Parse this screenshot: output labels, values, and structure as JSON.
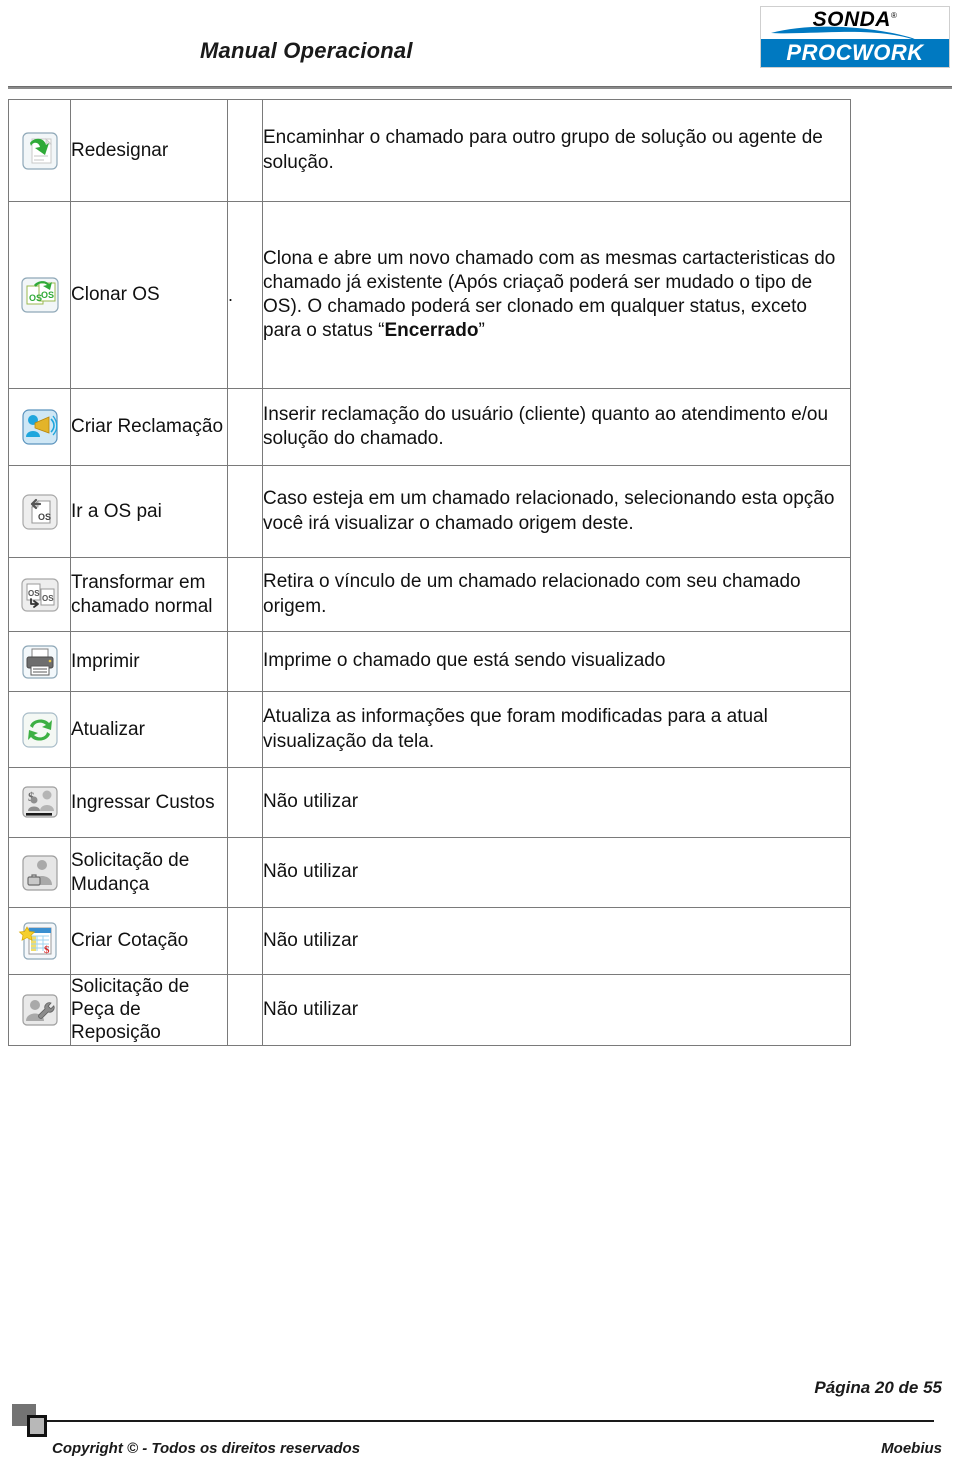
{
  "header": {
    "title": "Manual Operacional",
    "logo": {
      "top_text": "SONDA",
      "registered_mark": "®",
      "bottom_text": "PROCWORK",
      "brand_blue": "#0079c1"
    }
  },
  "table": {
    "rows": [
      {
        "icon": "redesignar-icon",
        "label": "Redesignar",
        "spacer": "",
        "desc_pre": "Encaminhar o chamado para outro grupo de solução ou agente de solução.",
        "desc_bold": "",
        "desc_post": ""
      },
      {
        "icon": "clonar-os-icon",
        "label": "Clonar OS",
        "spacer": ".",
        "desc_pre": "Clona e abre um novo chamado com as mesmas cartacteristicas do chamado já existente (Após criaçaõ poderá ser mudado o tipo de OS). O chamado poderá ser clonado em qualquer status, exceto para o status “",
        "desc_bold": "Encerrado",
        "desc_post": "”"
      },
      {
        "icon": "criar-reclamacao-icon",
        "label": "Criar Reclamação",
        "spacer": "",
        "desc_pre": "Inserir reclamação do usuário (cliente) quanto ao atendimento e/ou solução do chamado.",
        "desc_bold": "",
        "desc_post": ""
      },
      {
        "icon": "ir-a-os-pai-icon",
        "label": "Ir a OS pai",
        "spacer": "",
        "desc_pre": "Caso esteja em um chamado relacionado, selecionando esta opção você irá visualizar o chamado origem deste.",
        "desc_bold": "",
        "desc_post": ""
      },
      {
        "icon": "transformar-chamado-normal-icon",
        "label": "Transformar em chamado normal",
        "spacer": "",
        "desc_pre": "Retira o vínculo de um chamado relacionado com seu chamado origem.",
        "desc_bold": "",
        "desc_post": ""
      },
      {
        "icon": "imprimir-icon",
        "label": "Imprimir",
        "spacer": "",
        "desc_pre": "Imprime o chamado que está sendo visualizado",
        "desc_bold": "",
        "desc_post": ""
      },
      {
        "icon": "atualizar-icon",
        "label": "Atualizar",
        "spacer": "",
        "desc_pre": "Atualiza as informações que foram modificadas para a atual visualização da tela.",
        "desc_bold": "",
        "desc_post": ""
      },
      {
        "icon": "ingressar-custos-icon",
        "label": "Ingressar Custos",
        "spacer": "",
        "desc_pre": "Não utilizar",
        "desc_bold": "",
        "desc_post": ""
      },
      {
        "icon": "solicitacao-mudanca-icon",
        "label": "Solicitação de Mudança",
        "spacer": "",
        "desc_pre": "Não utilizar",
        "desc_bold": "",
        "desc_post": ""
      },
      {
        "icon": "criar-cotacao-icon",
        "label": "Criar Cotação",
        "spacer": "",
        "desc_pre": "Não utilizar",
        "desc_bold": "",
        "desc_post": ""
      },
      {
        "icon": "solicitacao-peca-reposicao-icon",
        "label": "Solicitação de Peça de Reposição",
        "spacer": "",
        "desc_pre": "Não utilizar",
        "desc_bold": "",
        "desc_post": ""
      }
    ]
  },
  "footer": {
    "page_label": "Página 20 de 55",
    "copyright": "Copyright © - Todos os direitos reservados",
    "brand": "Moebius"
  }
}
